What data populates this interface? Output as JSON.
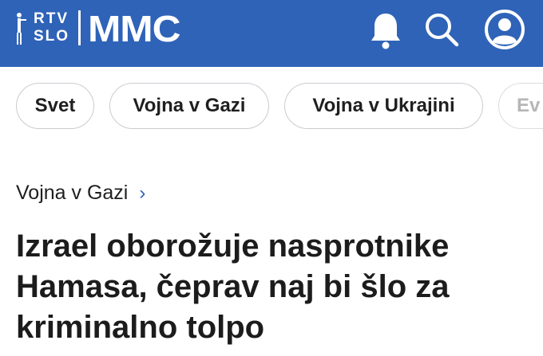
{
  "header": {
    "logo_line1": "RTV",
    "logo_line2": "SLO",
    "brand": "MMC",
    "icons": [
      "bell-icon",
      "search-icon",
      "user-icon"
    ]
  },
  "chips": [
    "Svet",
    "Vojna v Gazi",
    "Vojna v Ukrajini",
    "Ev"
  ],
  "breadcrumb": {
    "label": "Vojna v Gazi",
    "arrow": "›"
  },
  "article": {
    "title": "Izrael oborožuje nasprotnike Hamasa, čeprav naj bi šlo za kriminalno tolpo"
  },
  "colors": {
    "header_bg": "#2f63b8",
    "accent": "#2f63b8"
  }
}
